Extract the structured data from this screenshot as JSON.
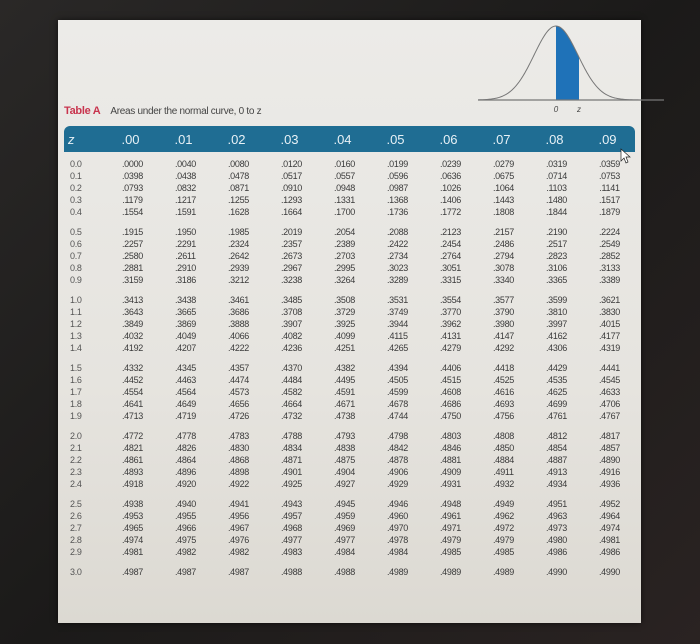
{
  "table": {
    "label": "Table A",
    "caption": "Areas under the normal curve, 0 to z",
    "figure": {
      "left_tick": "0",
      "right_tick": "z",
      "shade_color": "#1f72b8"
    },
    "header_color": "#1f6d93",
    "columns": [
      "z",
      ".00",
      ".01",
      ".02",
      ".03",
      ".04",
      ".05",
      ".06",
      ".07",
      ".08",
      ".09"
    ],
    "groups": [
      {
        "rows": [
          {
            "z": "0.0",
            "values": [
              ".0000",
              ".0040",
              ".0080",
              ".0120",
              ".0160",
              ".0199",
              ".0239",
              ".0279",
              ".0319",
              ".0359"
            ]
          },
          {
            "z": "0.1",
            "values": [
              ".0398",
              ".0438",
              ".0478",
              ".0517",
              ".0557",
              ".0596",
              ".0636",
              ".0675",
              ".0714",
              ".0753"
            ]
          },
          {
            "z": "0.2",
            "values": [
              ".0793",
              ".0832",
              ".0871",
              ".0910",
              ".0948",
              ".0987",
              ".1026",
              ".1064",
              ".1103",
              ".1141"
            ]
          },
          {
            "z": "0.3",
            "values": [
              ".1179",
              ".1217",
              ".1255",
              ".1293",
              ".1331",
              ".1368",
              ".1406",
              ".1443",
              ".1480",
              ".1517"
            ]
          },
          {
            "z": "0.4",
            "values": [
              ".1554",
              ".1591",
              ".1628",
              ".1664",
              ".1700",
              ".1736",
              ".1772",
              ".1808",
              ".1844",
              ".1879"
            ]
          }
        ]
      },
      {
        "rows": [
          {
            "z": "0.5",
            "values": [
              ".1915",
              ".1950",
              ".1985",
              ".2019",
              ".2054",
              ".2088",
              ".2123",
              ".2157",
              ".2190",
              ".2224"
            ]
          },
          {
            "z": "0.6",
            "values": [
              ".2257",
              ".2291",
              ".2324",
              ".2357",
              ".2389",
              ".2422",
              ".2454",
              ".2486",
              ".2517",
              ".2549"
            ]
          },
          {
            "z": "0.7",
            "values": [
              ".2580",
              ".2611",
              ".2642",
              ".2673",
              ".2703",
              ".2734",
              ".2764",
              ".2794",
              ".2823",
              ".2852"
            ]
          },
          {
            "z": "0.8",
            "values": [
              ".2881",
              ".2910",
              ".2939",
              ".2967",
              ".2995",
              ".3023",
              ".3051",
              ".3078",
              ".3106",
              ".3133"
            ]
          },
          {
            "z": "0.9",
            "values": [
              ".3159",
              ".3186",
              ".3212",
              ".3238",
              ".3264",
              ".3289",
              ".3315",
              ".3340",
              ".3365",
              ".3389"
            ]
          }
        ]
      },
      {
        "rows": [
          {
            "z": "1.0",
            "values": [
              ".3413",
              ".3438",
              ".3461",
              ".3485",
              ".3508",
              ".3531",
              ".3554",
              ".3577",
              ".3599",
              ".3621"
            ]
          },
          {
            "z": "1.1",
            "values": [
              ".3643",
              ".3665",
              ".3686",
              ".3708",
              ".3729",
              ".3749",
              ".3770",
              ".3790",
              ".3810",
              ".3830"
            ]
          },
          {
            "z": "1.2",
            "values": [
              ".3849",
              ".3869",
              ".3888",
              ".3907",
              ".3925",
              ".3944",
              ".3962",
              ".3980",
              ".3997",
              ".4015"
            ]
          },
          {
            "z": "1.3",
            "values": [
              ".4032",
              ".4049",
              ".4066",
              ".4082",
              ".4099",
              ".4115",
              ".4131",
              ".4147",
              ".4162",
              ".4177"
            ]
          },
          {
            "z": "1.4",
            "values": [
              ".4192",
              ".4207",
              ".4222",
              ".4236",
              ".4251",
              ".4265",
              ".4279",
              ".4292",
              ".4306",
              ".4319"
            ]
          }
        ]
      },
      {
        "rows": [
          {
            "z": "1.5",
            "values": [
              ".4332",
              ".4345",
              ".4357",
              ".4370",
              ".4382",
              ".4394",
              ".4406",
              ".4418",
              ".4429",
              ".4441"
            ]
          },
          {
            "z": "1.6",
            "values": [
              ".4452",
              ".4463",
              ".4474",
              ".4484",
              ".4495",
              ".4505",
              ".4515",
              ".4525",
              ".4535",
              ".4545"
            ]
          },
          {
            "z": "1.7",
            "values": [
              ".4554",
              ".4564",
              ".4573",
              ".4582",
              ".4591",
              ".4599",
              ".4608",
              ".4616",
              ".4625",
              ".4633"
            ]
          },
          {
            "z": "1.8",
            "values": [
              ".4641",
              ".4649",
              ".4656",
              ".4664",
              ".4671",
              ".4678",
              ".4686",
              ".4693",
              ".4699",
              ".4706"
            ]
          },
          {
            "z": "1.9",
            "values": [
              ".4713",
              ".4719",
              ".4726",
              ".4732",
              ".4738",
              ".4744",
              ".4750",
              ".4756",
              ".4761",
              ".4767"
            ]
          }
        ]
      },
      {
        "rows": [
          {
            "z": "2.0",
            "values": [
              ".4772",
              ".4778",
              ".4783",
              ".4788",
              ".4793",
              ".4798",
              ".4803",
              ".4808",
              ".4812",
              ".4817"
            ]
          },
          {
            "z": "2.1",
            "values": [
              ".4821",
              ".4826",
              ".4830",
              ".4834",
              ".4838",
              ".4842",
              ".4846",
              ".4850",
              ".4854",
              ".4857"
            ]
          },
          {
            "z": "2.2",
            "values": [
              ".4861",
              ".4864",
              ".4868",
              ".4871",
              ".4875",
              ".4878",
              ".4881",
              ".4884",
              ".4887",
              ".4890"
            ]
          },
          {
            "z": "2.3",
            "values": [
              ".4893",
              ".4896",
              ".4898",
              ".4901",
              ".4904",
              ".4906",
              ".4909",
              ".4911",
              ".4913",
              ".4916"
            ]
          },
          {
            "z": "2.4",
            "values": [
              ".4918",
              ".4920",
              ".4922",
              ".4925",
              ".4927",
              ".4929",
              ".4931",
              ".4932",
              ".4934",
              ".4936"
            ]
          }
        ]
      },
      {
        "rows": [
          {
            "z": "2.5",
            "values": [
              ".4938",
              ".4940",
              ".4941",
              ".4943",
              ".4945",
              ".4946",
              ".4948",
              ".4949",
              ".4951",
              ".4952"
            ]
          },
          {
            "z": "2.6",
            "values": [
              ".4953",
              ".4955",
              ".4956",
              ".4957",
              ".4959",
              ".4960",
              ".4961",
              ".4962",
              ".4963",
              ".4964"
            ]
          },
          {
            "z": "2.7",
            "values": [
              ".4965",
              ".4966",
              ".4967",
              ".4968",
              ".4969",
              ".4970",
              ".4971",
              ".4972",
              ".4973",
              ".4974"
            ]
          },
          {
            "z": "2.8",
            "values": [
              ".4974",
              ".4975",
              ".4976",
              ".4977",
              ".4977",
              ".4978",
              ".4979",
              ".4979",
              ".4980",
              ".4981"
            ]
          },
          {
            "z": "2.9",
            "values": [
              ".4981",
              ".4982",
              ".4982",
              ".4983",
              ".4984",
              ".4984",
              ".4985",
              ".4985",
              ".4986",
              ".4986"
            ]
          }
        ]
      },
      {
        "rows": [
          {
            "z": "3.0",
            "values": [
              ".4987",
              ".4987",
              ".4987",
              ".4988",
              ".4988",
              ".4989",
              ".4989",
              ".4989",
              ".4990",
              ".4990"
            ]
          }
        ]
      }
    ]
  }
}
